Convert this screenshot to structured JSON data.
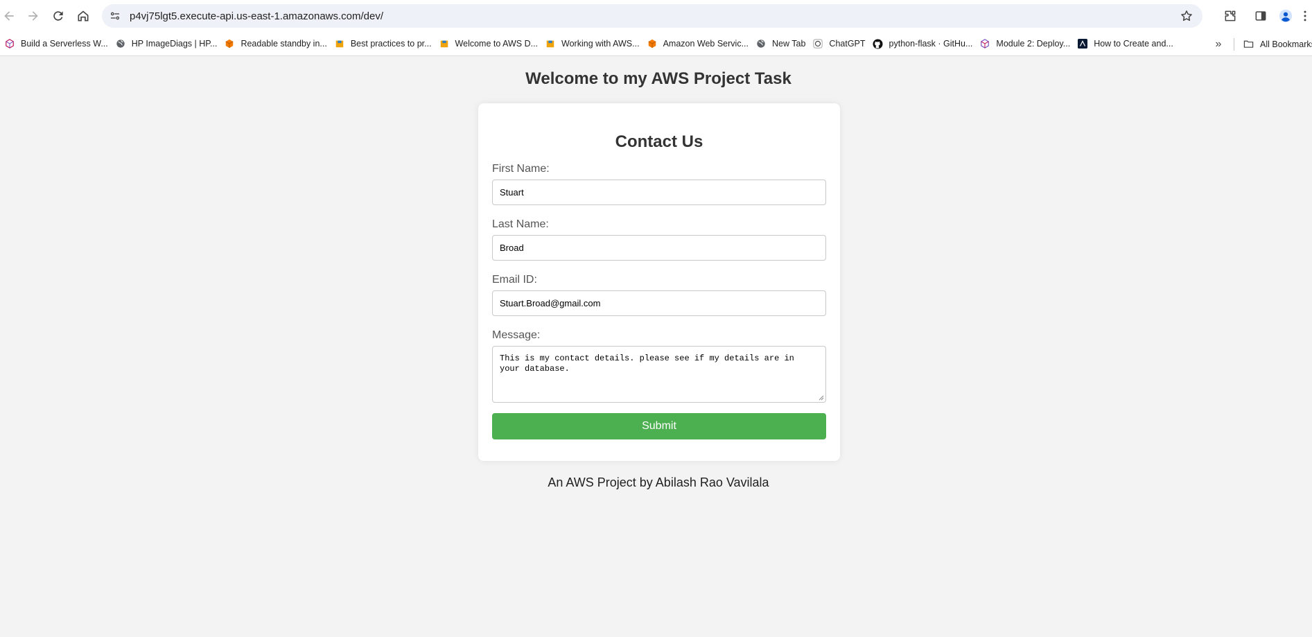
{
  "browser": {
    "url": "p4vj75lgt5.execute-api.us-east-1.amazonaws.com/dev/",
    "bookmarks": [
      {
        "label": "Build a Serverless W...",
        "icon": "cube-icon",
        "color": "#c2185b"
      },
      {
        "label": "HP ImageDiags | HP...",
        "icon": "globe-icon",
        "color": "#5f6368"
      },
      {
        "label": "Readable standby in...",
        "icon": "aws-service-icon",
        "color": "#f57c00"
      },
      {
        "label": "Best practices to pr...",
        "icon": "aws-box-icon",
        "color": "#f0a30a"
      },
      {
        "label": "Welcome to AWS D...",
        "icon": "aws-box-icon",
        "color": "#f0a30a"
      },
      {
        "label": "Working with AWS...",
        "icon": "aws-box-icon",
        "color": "#f0a30a"
      },
      {
        "label": "Amazon Web Servic...",
        "icon": "aws-service-icon",
        "color": "#f57c00"
      },
      {
        "label": "New Tab",
        "icon": "globe-icon",
        "color": "#5f6368"
      },
      {
        "label": "ChatGPT",
        "icon": "chatgpt-icon",
        "color": "#10a37f"
      },
      {
        "label": "python-flask · GitHu...",
        "icon": "github-icon",
        "color": "#000000"
      },
      {
        "label": "Module 2: Deploy...",
        "icon": "cube-icon",
        "color": "#7e57c2"
      },
      {
        "label": "How to Create and...",
        "icon": "site-logo-icon",
        "color": "#0b1a33"
      }
    ],
    "all_bookmarks_label": "All Bookmarks"
  },
  "page": {
    "title": "Welcome to my AWS Project Task",
    "form": {
      "title": "Contact Us",
      "first_name_label": "First Name:",
      "first_name_value": "Stuart",
      "last_name_label": "Last Name:",
      "last_name_value": "Broad",
      "email_label": "Email ID:",
      "email_value": "Stuart.Broad@gmail.com",
      "message_label": "Message:",
      "message_value": "This is my contact details. please see if my details are in your database.",
      "submit_label": "Submit"
    },
    "footer": "An AWS Project by Abilash Rao Vavilala"
  },
  "colors": {
    "submit": "#4caf50",
    "background": "#f3f3f3"
  }
}
